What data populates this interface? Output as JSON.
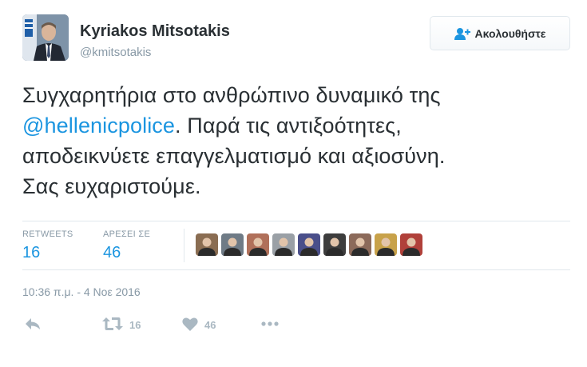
{
  "user": {
    "fullname": "Kyriakos Mitsotakis",
    "username": "@kmitsotakis"
  },
  "follow_button": {
    "label": "Ακολουθήστε",
    "icon": "follow-user-icon"
  },
  "tweet": {
    "line1": "Συγχαρητήρια στο ανθρώπινο δυναμικό της",
    "mention": "@hellenicpolice",
    "line2_rest": ". Παρά τις αντιξοότητες,",
    "line3": "αποδεικνύετε επαγγελματισμό και αξιοσύνη.",
    "line4": "Σας ευχαριστούμε."
  },
  "stats": {
    "retweets_label": "RETWEETS",
    "retweets_value": "16",
    "likes_label": "ΑΡΕΣΕΙ ΣΕ",
    "likes_value": "46"
  },
  "likers": [
    {
      "icon": "avatar-icon",
      "color": "#8a6d52"
    },
    {
      "icon": "avatar-icon",
      "color": "#6f7b86"
    },
    {
      "icon": "avatar-icon",
      "color": "#b0705a"
    },
    {
      "icon": "avatar-icon",
      "color": "#9aa0a6"
    },
    {
      "icon": "avatar-icon",
      "color": "#4a4f8a"
    },
    {
      "icon": "avatar-icon",
      "color": "#3d3d3d"
    },
    {
      "icon": "avatar-icon",
      "color": "#8c6a5a"
    },
    {
      "icon": "avatar-icon",
      "color": "#c8a24a"
    },
    {
      "icon": "avatar-icon",
      "color": "#b0403a"
    }
  ],
  "timestamp": "10:36 π.μ. - 4 Νοε 2016",
  "actions": {
    "reply_icon": "reply-icon",
    "retweet_icon": "retweet-icon",
    "retweet_count": "16",
    "like_icon": "heart-icon",
    "like_count": "46",
    "more_icon": "more-icon"
  },
  "colors": {
    "link": "#1b95e0",
    "muted": "#8899a6",
    "action": "#aab8c2",
    "text": "#292f33"
  }
}
